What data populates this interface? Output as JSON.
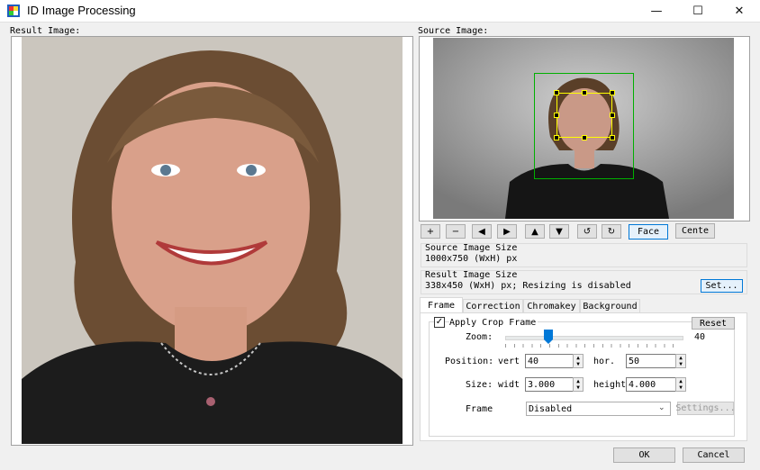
{
  "window": {
    "title": "ID Image Processing",
    "minimize": "—",
    "maximize": "☐",
    "close": "✕"
  },
  "result": {
    "label": "Result Image:"
  },
  "source": {
    "label": "Source Image:"
  },
  "toolbar": {
    "zoom_in": "+",
    "zoom_out": "−",
    "left": "◀",
    "right": "▶",
    "up": "▲",
    "down": "▼",
    "rotate_left": "↺",
    "rotate_right": "↻",
    "face": "Face",
    "center": "Cente"
  },
  "source_size": {
    "title": "Source Image Size",
    "value": "1000x750 (WxH) px"
  },
  "result_size": {
    "title": "Result Image Size",
    "value": "338x450 (WxH) px; Resizing is disabled",
    "set_button": "Set..."
  },
  "tabs": [
    "Frame",
    "Correction",
    "Chromakey",
    "Background"
  ],
  "frame": {
    "apply_crop_label": "Apply Crop Frame",
    "apply_crop_checked": true,
    "reset_button": "Reset",
    "zoom_label": "Zoom:",
    "zoom_value": "40",
    "zoom_fraction": 0.25,
    "position_label": "Position:",
    "vert_label": "vert",
    "vert_value": "40",
    "hor_label": "hor.",
    "hor_value": "50",
    "size_label": "Size:",
    "width_label": "widt",
    "width_value": "3.000",
    "height_label": "height",
    "height_value": "4.000",
    "frame_label": "Frame",
    "frame_value": "Disabled",
    "settings_button": "Settings..."
  },
  "footer": {
    "ok": "OK",
    "cancel": "Cancel"
  }
}
